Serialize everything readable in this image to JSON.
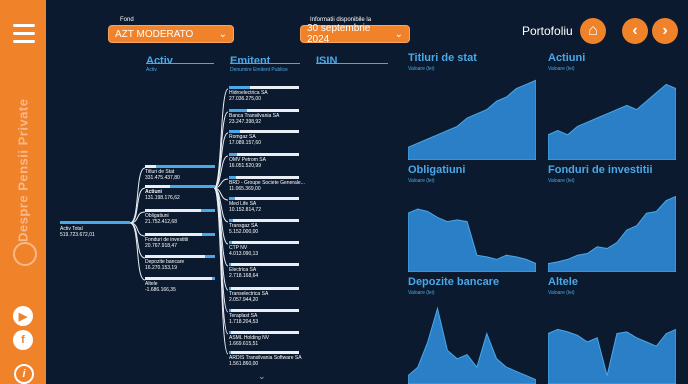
{
  "sidebar": {
    "vertical_text": "Despre Pensii Private",
    "icons": [
      "youtube-icon",
      "facebook-icon",
      "info-icon"
    ]
  },
  "topbar": {
    "fund_label": "Fond",
    "fund_value": "AZT MODERATO",
    "date_label": "Informatii disponibile la",
    "date_value": "30 septembrie 2024",
    "portofoliu": "Portofoliu"
  },
  "tree": {
    "columns": [
      {
        "title": "Activ",
        "subtitle": "Activ"
      },
      {
        "title": "Emitent",
        "subtitle": "Denumire Emitent Publice"
      },
      {
        "title": "ISIN",
        "subtitle": ""
      }
    ],
    "root": {
      "label": "Activ Total",
      "value": "519.723.672,01"
    },
    "assets": [
      {
        "label": "Titluri de Stat",
        "value": "331.475.437,80"
      },
      {
        "label": "Actiuni",
        "value": "131.198.176,62"
      },
      {
        "label": "Obligatiuni",
        "value": "21.752.412,68"
      },
      {
        "label": "Fonduri de investitii",
        "value": "20.767.918,47"
      },
      {
        "label": "Depozite bancare",
        "value": "16.270.153,19"
      },
      {
        "label": "Altele",
        "value": "-1.686.166,35"
      }
    ],
    "emitents": [
      {
        "label": "Hidroelectrica SA",
        "value": "27.036.275,00"
      },
      {
        "label": "Banca Transilvania SA",
        "value": "23.247.398,92"
      },
      {
        "label": "Romgaz SA",
        "value": "17.089.157,60"
      },
      {
        "label": "OMV Petrom SA",
        "value": "16.051.520,99"
      },
      {
        "label": "BRD - Groupe Societe Generale...",
        "value": "11.065.369,00"
      },
      {
        "label": "Med Life SA",
        "value": "10.152.814,72"
      },
      {
        "label": "Transgaz SA",
        "value": "5.152.000,00"
      },
      {
        "label": "CTP NV",
        "value": "4.013.090,13"
      },
      {
        "label": "Electrica SA",
        "value": "2.718.168,64"
      },
      {
        "label": "Transelectrica SA",
        "value": "2.057.944,20"
      },
      {
        "label": "Teraplast SA",
        "value": "1.718.204,53"
      },
      {
        "label": "ASML Holding NV",
        "value": "1.669.615,51"
      },
      {
        "label": "ARDIS Transilvania Software SA",
        "value": "1.561.860,00"
      }
    ]
  },
  "panels": [
    {
      "title": "Titluri de stat",
      "sub": "Valoare (lei)"
    },
    {
      "title": "Actiuni",
      "sub": "Valoare (lei)"
    },
    {
      "title": "Obligatiuni",
      "sub": "Valoare (lei)"
    },
    {
      "title": "Fonduri de investitii",
      "sub": "Valoare (lei)"
    },
    {
      "title": "Depozite bancare",
      "sub": "Valoare (lei)"
    },
    {
      "title": "Altele",
      "sub": "Valoare (lei)"
    }
  ],
  "colors": {
    "accent": "#f0822a",
    "blue": "#4aa8e8",
    "bg": "#0b1a2e"
  }
}
